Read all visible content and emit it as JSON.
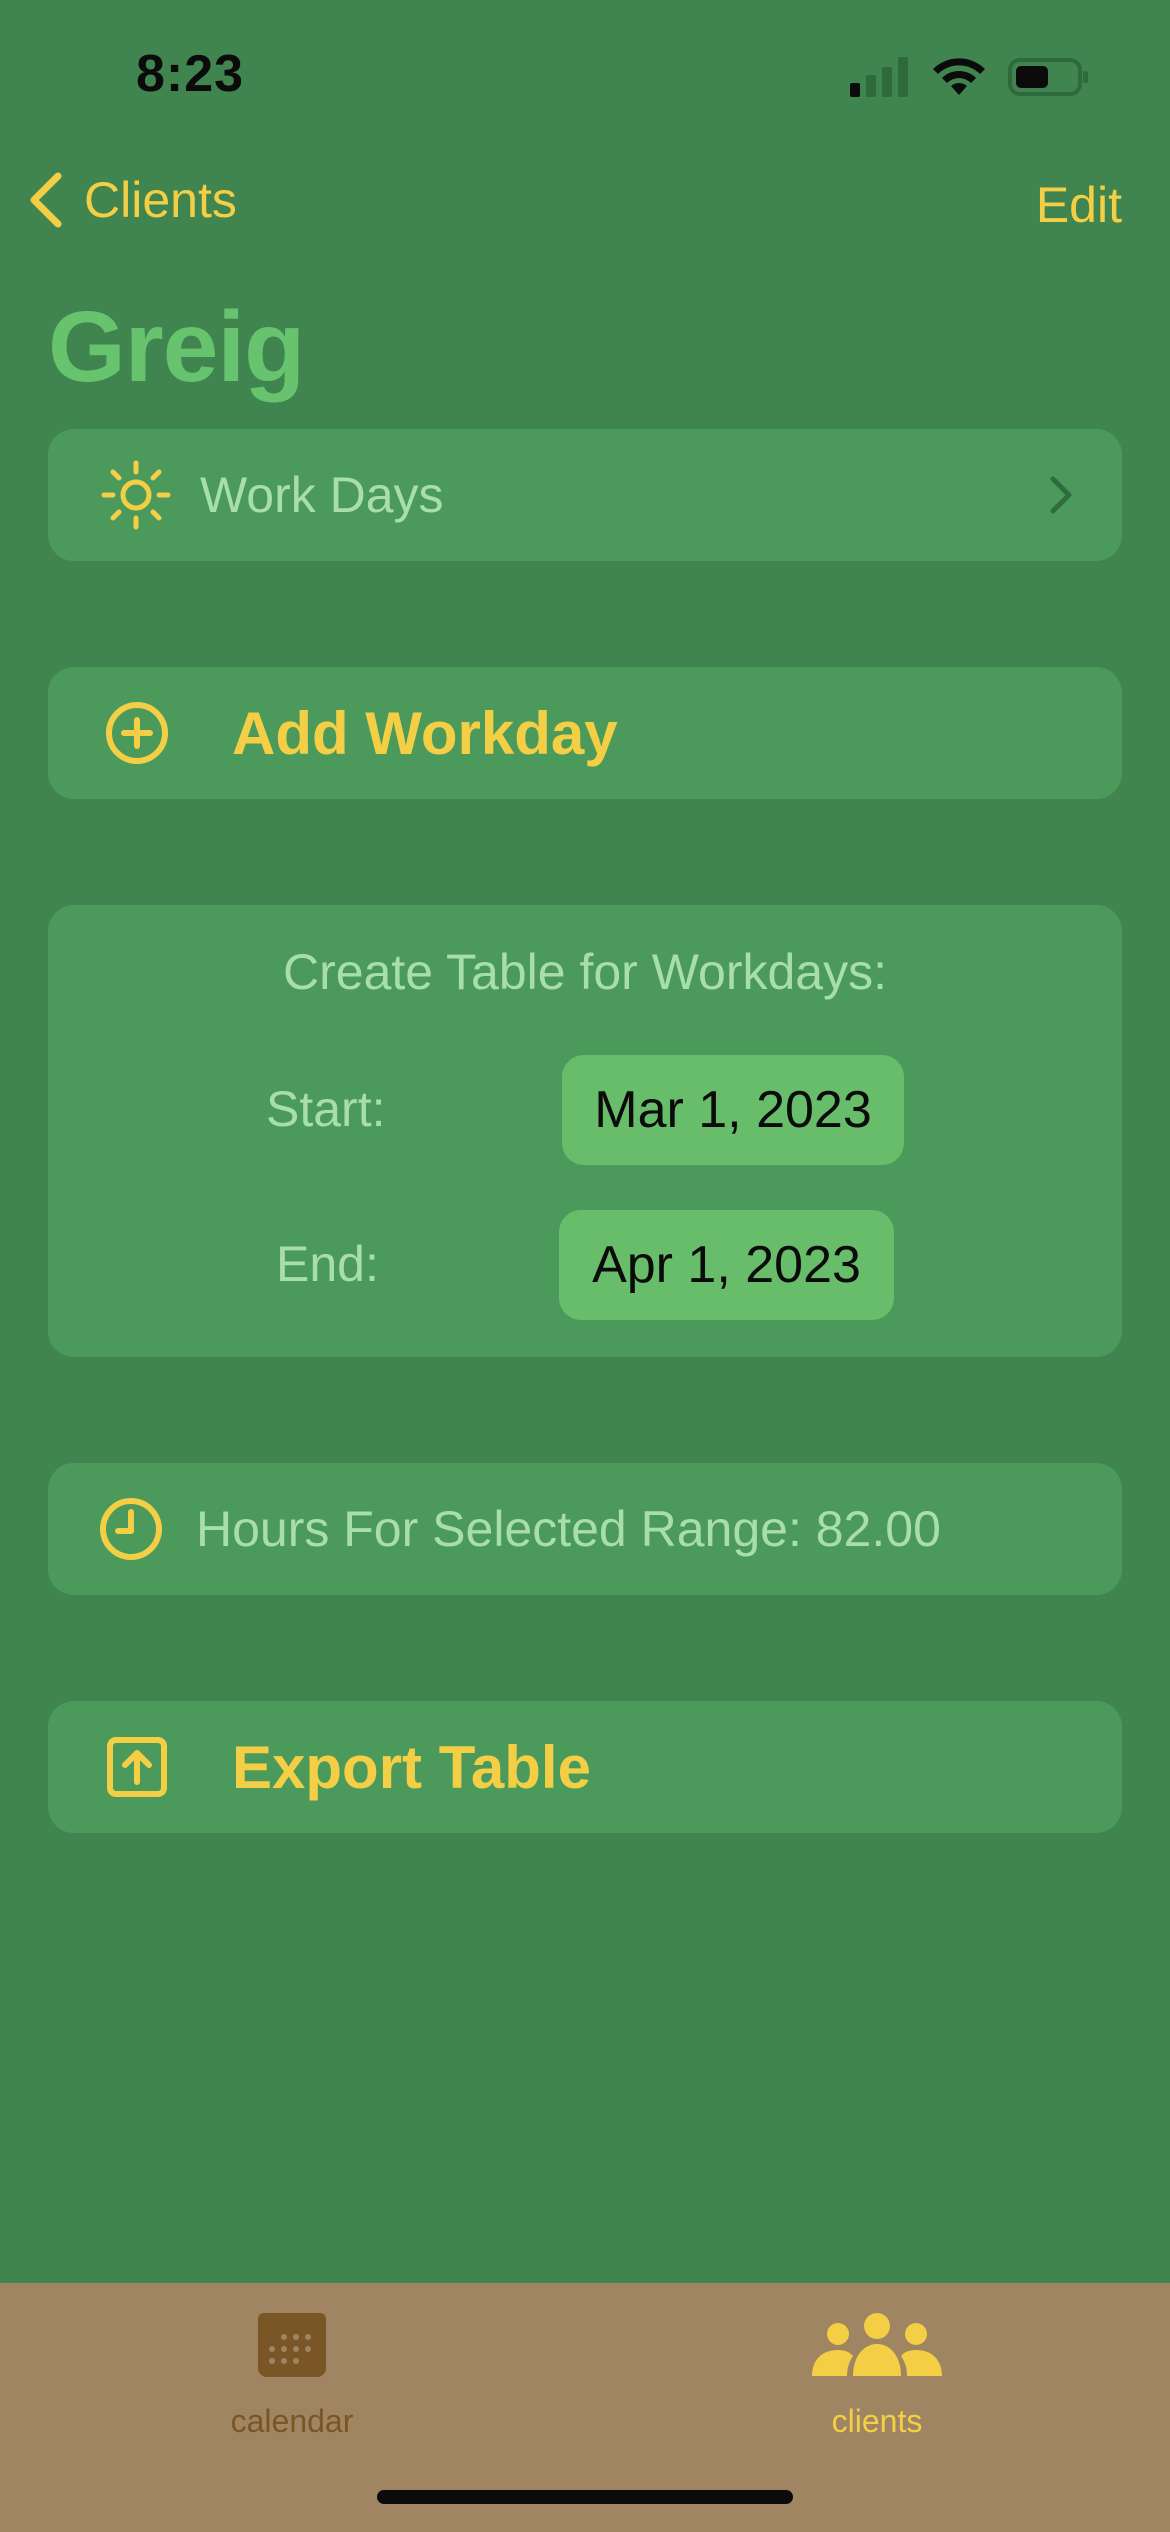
{
  "status_bar": {
    "time": "8:23"
  },
  "nav": {
    "back_label": "Clients",
    "edit_label": "Edit",
    "title": "Greig"
  },
  "workdays": {
    "label": "Work Days",
    "icon": "sun-icon"
  },
  "add_workday": {
    "label": "Add Workday",
    "icon": "plus-circle-icon"
  },
  "table": {
    "title": "Create Table for Workdays:",
    "start_label": "Start:",
    "start_value": "Mar 1, 2023",
    "end_label": "End:",
    "end_value": "Apr 1, 2023"
  },
  "hours": {
    "label": "Hours For Selected Range: 82.00",
    "icon": "clock-icon"
  },
  "export": {
    "label": "Export Table",
    "icon": "export-icon"
  },
  "tabbar": {
    "tabs": [
      {
        "label": "calendar",
        "icon": "calendar-icon",
        "selected": false
      },
      {
        "label": "clients",
        "icon": "people-icon",
        "selected": true
      }
    ]
  },
  "colors": {
    "background": "#408550",
    "card": "#4b9a5c",
    "accent": "#f4cf45",
    "muted_text": "#a8dea9",
    "title": "#67c36d",
    "pill": "#67bd6a",
    "tabbar": "#9f8562"
  }
}
